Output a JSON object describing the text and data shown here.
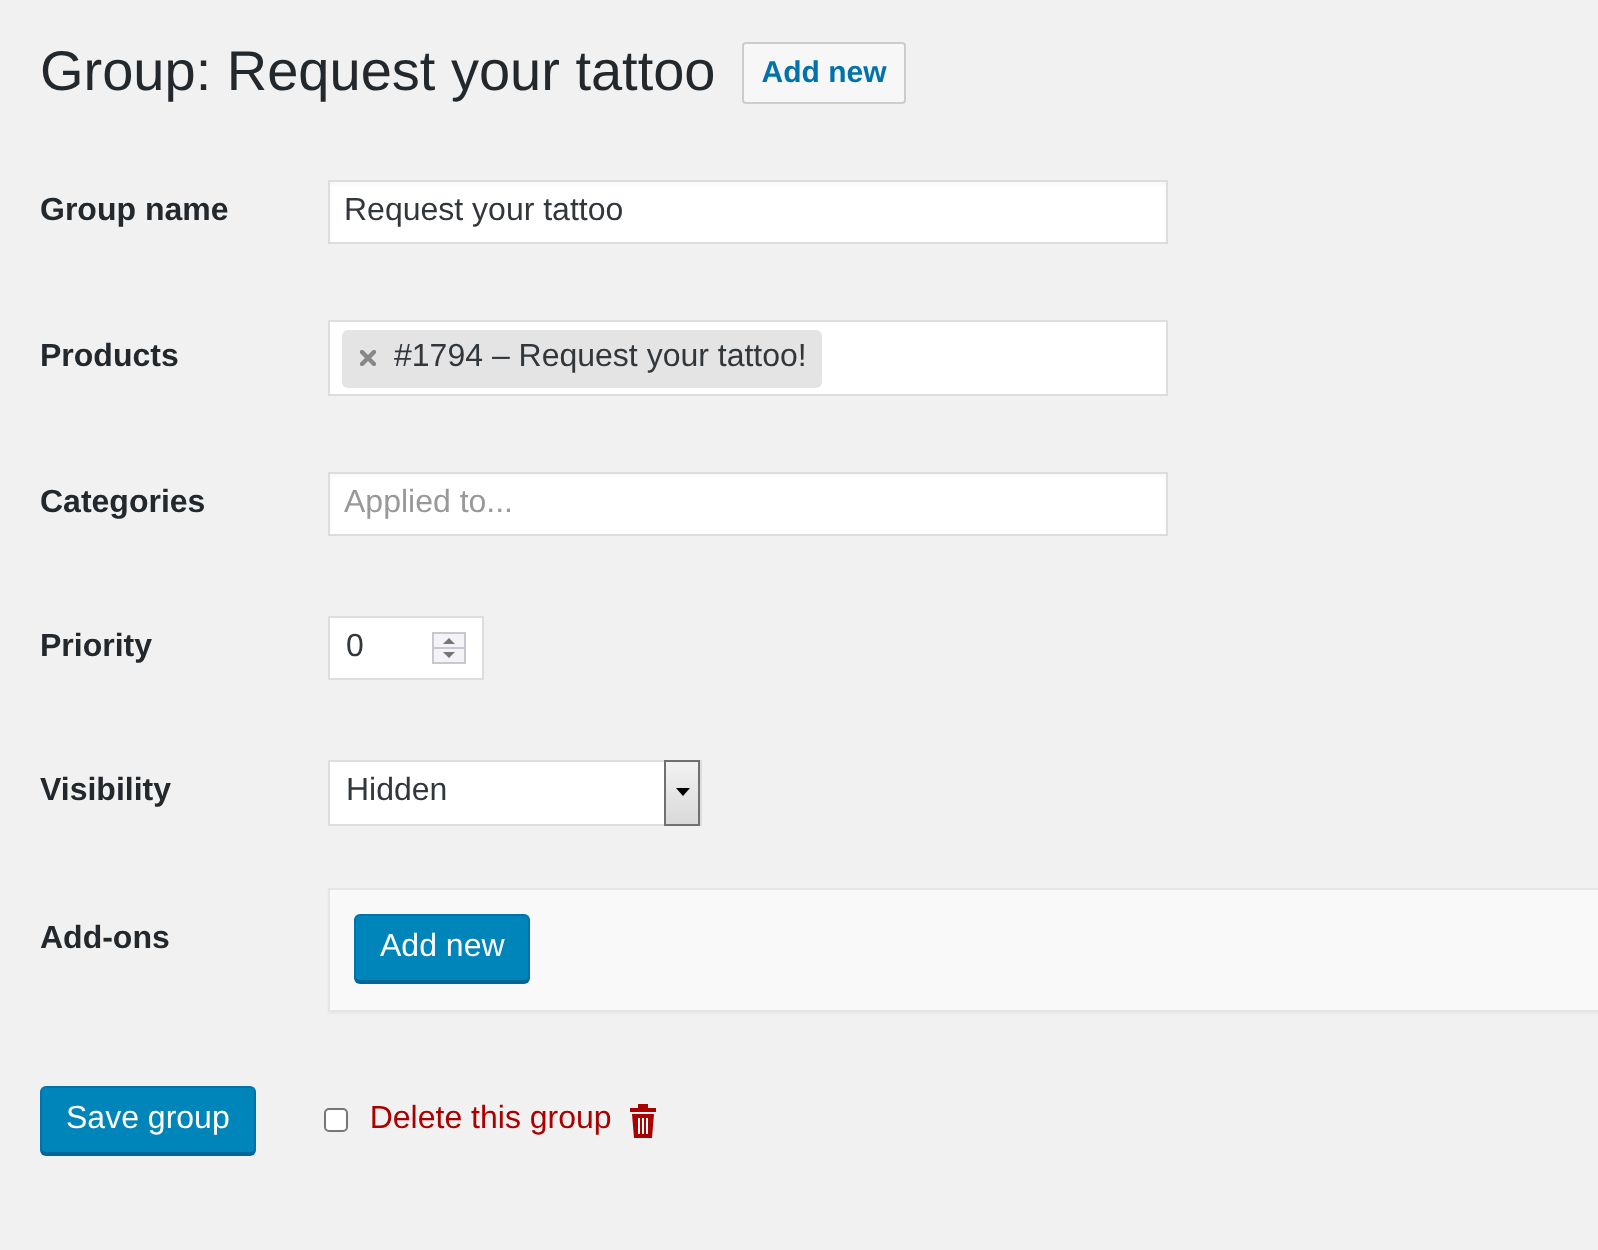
{
  "page_title": "Group: Request your tattoo",
  "header_button": "Add new",
  "fields": [
    {
      "kind": "text",
      "label": "Group name",
      "value": "Request your tattoo"
    },
    {
      "kind": "tags",
      "label": "Products",
      "tags": [
        "#1794 – Request your tattoo!"
      ]
    },
    {
      "kind": "text",
      "label": "Categories",
      "placeholder": "Applied to..."
    },
    {
      "kind": "number",
      "label": "Priority",
      "value": "0"
    },
    {
      "kind": "select",
      "label": "Visibility",
      "value": "Hidden"
    },
    {
      "kind": "panel",
      "label": "Add-ons",
      "button": "Add new"
    }
  ],
  "footer": {
    "save_button": "Save group",
    "delete": {
      "label": "Delete this group",
      "checked": false
    }
  }
}
